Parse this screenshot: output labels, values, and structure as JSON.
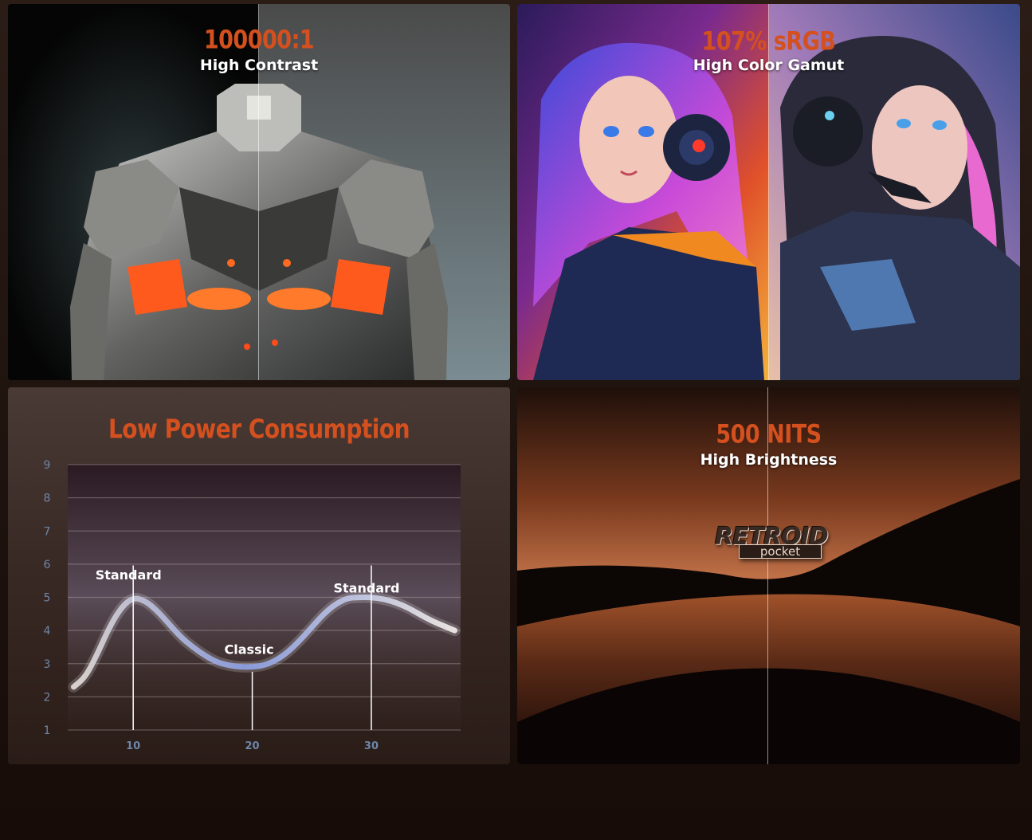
{
  "panels": {
    "contrast": {
      "title": "100000:1",
      "subtitle": "High Contrast"
    },
    "gamut": {
      "title": "107% sRGB",
      "subtitle": "High Color Gamut"
    },
    "power": {
      "title": "Low Power Consumption"
    },
    "brightness": {
      "title": "500 NITS",
      "subtitle": "High Brightness",
      "logo_main": "RETROID",
      "logo_sub": "pocket"
    }
  },
  "colors": {
    "accent": "#d4501f",
    "text": "#ffffff",
    "axis_text": "#6e86a8"
  },
  "chart_data": {
    "type": "line",
    "title": "Low Power Consumption",
    "xlabel": "",
    "ylabel": "",
    "xlim": [
      4.5,
      37.5
    ],
    "ylim": [
      1,
      9
    ],
    "x_ticks": [
      10,
      20,
      30
    ],
    "y_ticks": [
      1,
      2,
      3,
      4,
      5,
      6,
      7,
      8,
      9
    ],
    "grid": true,
    "series": [
      {
        "x": [
          5,
          6,
          7,
          8,
          9,
          10,
          11,
          12,
          13,
          14,
          15,
          16,
          17,
          18,
          19,
          20,
          21,
          22,
          23,
          24,
          25,
          26,
          27,
          28,
          29,
          30,
          31,
          32,
          33,
          34,
          35,
          36,
          37
        ],
        "y": [
          2.3,
          2.6,
          3.3,
          4.1,
          4.7,
          5.0,
          4.9,
          4.6,
          4.2,
          3.8,
          3.5,
          3.25,
          3.05,
          2.95,
          2.9,
          2.9,
          2.95,
          3.1,
          3.35,
          3.7,
          4.1,
          4.5,
          4.8,
          4.98,
          5.0,
          5.0,
          4.95,
          4.85,
          4.7,
          4.5,
          4.3,
          4.15,
          4.0
        ]
      }
    ],
    "annotations": [
      {
        "label": "Standard",
        "x": 10,
        "y": 5.0,
        "label_y": 5.45
      },
      {
        "label": "Classic",
        "x": 20,
        "y": 2.9,
        "label_y": 3.2
      },
      {
        "label": "Standard",
        "x": 30,
        "y": 5.0,
        "label_y": 5.05
      }
    ]
  }
}
